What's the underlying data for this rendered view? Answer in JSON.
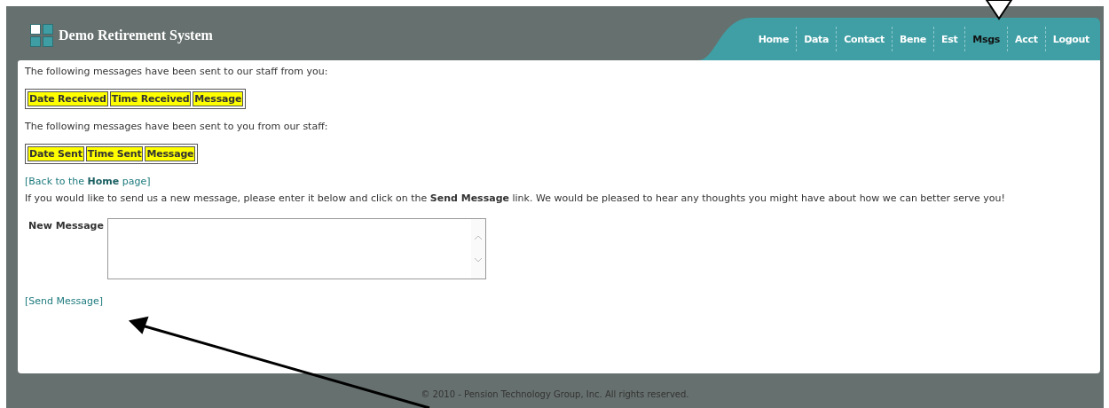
{
  "header": {
    "title": "Demo Retirement System"
  },
  "nav": [
    {
      "label": "Home",
      "selected": false
    },
    {
      "label": "Data",
      "selected": false
    },
    {
      "label": "Contact",
      "selected": false
    },
    {
      "label": "Bene",
      "selected": false
    },
    {
      "label": "Est",
      "selected": false
    },
    {
      "label": "Msgs",
      "selected": true
    },
    {
      "label": "Acct",
      "selected": false
    },
    {
      "label": "Logout",
      "selected": false
    }
  ],
  "sent_section": {
    "intro": "The following messages have been sent to our staff from you:",
    "columns": [
      "Date Received",
      "Time Received",
      "Message"
    ]
  },
  "received_section": {
    "intro": "The following messages have been sent to you from our staff:",
    "columns": [
      "Date Sent",
      "Time Sent",
      "Message"
    ]
  },
  "back_link": "[Back to the **Home** page]",
  "instructions": "If you would like to send us a new message, please enter it below and click on the **Send Message** link. We would be pleased to hear any thoughts you might have about how we can better serve you!",
  "form": {
    "label": "New Message"
  },
  "send_link": "[Send Message]",
  "footer": "© 2010 - Pension Technology Group, Inc. All rights reserved.",
  "annotations": [
    {
      "kind": "outline-arrow"
    },
    {
      "kind": "solid-arrow"
    }
  ]
}
